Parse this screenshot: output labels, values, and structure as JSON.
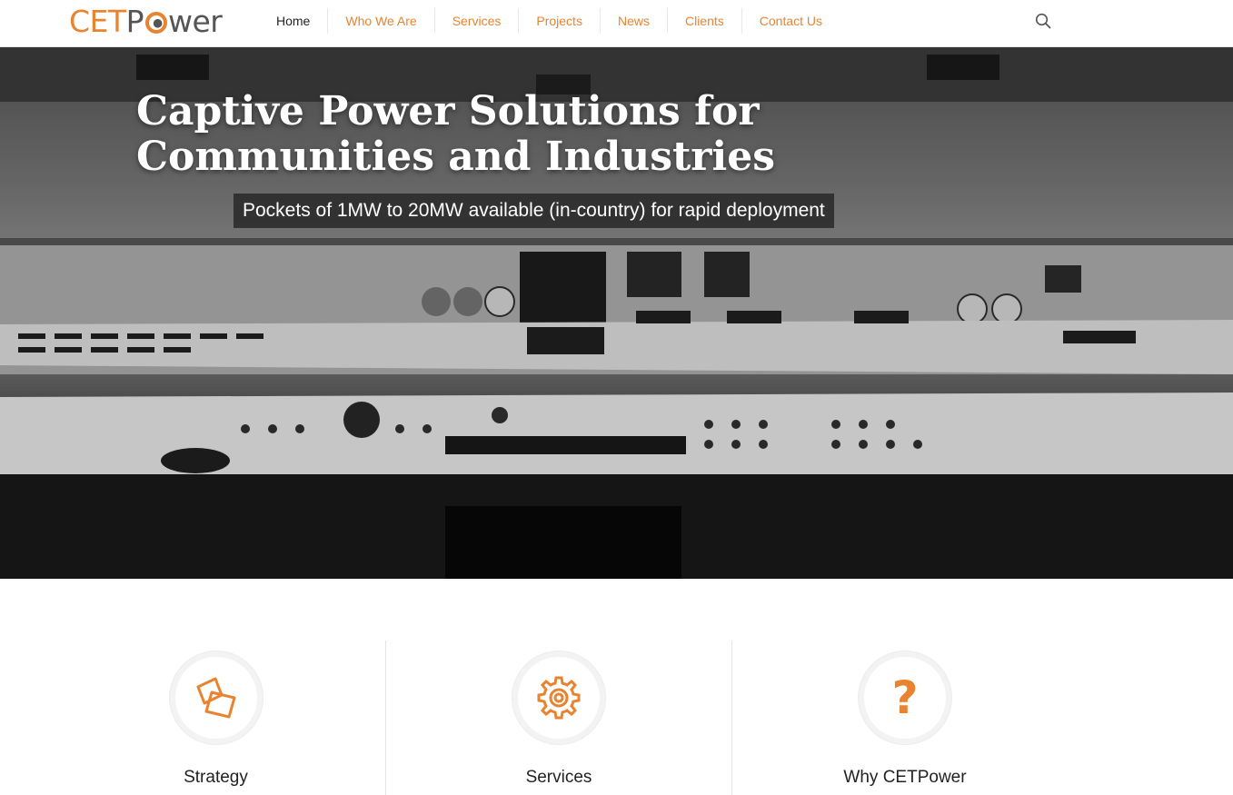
{
  "brand": {
    "logo_left": "CET",
    "logo_right": "wer",
    "accent": "#e9832f"
  },
  "nav": {
    "items": [
      {
        "label": "Home"
      },
      {
        "label": "Who We Are"
      },
      {
        "label": "Services"
      },
      {
        "label": "Projects"
      },
      {
        "label": "News"
      },
      {
        "label": "Clients"
      },
      {
        "label": "Contact Us"
      }
    ],
    "search_icon": "search-icon"
  },
  "hero": {
    "title": "Captive Power Solutions for Communities and Industries",
    "subtitle": "Pockets of 1MW to 20MW available (in-country) for rapid deployment"
  },
  "features": [
    {
      "title": "Strategy",
      "icon": "strategy-icon"
    },
    {
      "title": "Services",
      "icon": "gear-icon"
    },
    {
      "title": "Why CETPower",
      "icon": "question-icon"
    }
  ]
}
